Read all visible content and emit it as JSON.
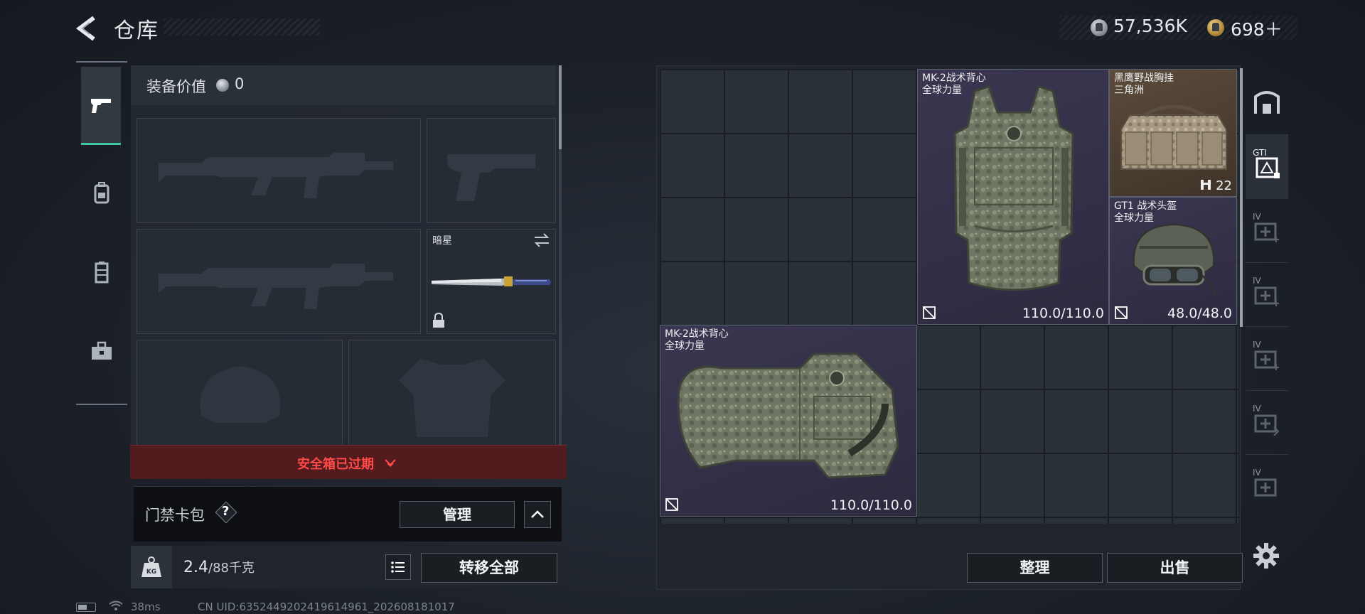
{
  "header": {
    "title": "仓库",
    "currency_silver": "57,536K",
    "currency_gold": "698＋"
  },
  "side_tabs": [
    {
      "icon": "pistol-icon",
      "active": true
    },
    {
      "icon": "backpack-icon",
      "active": false
    },
    {
      "icon": "vest-icon",
      "active": false
    },
    {
      "icon": "toolbox-icon",
      "active": false
    }
  ],
  "equipment": {
    "value_label": "装备价值",
    "value": "0",
    "melee_name": "暗星",
    "safebox_expired": "安全箱已过期",
    "keycard_label": "门禁卡包",
    "manage_label": "管理",
    "weight_current": "2.4",
    "weight_max": "/88千克",
    "transfer_all_label": "转移全部"
  },
  "status": {
    "ping": "38ms",
    "uid": "CN UID:6352449202419614961_202608181017"
  },
  "stash_items": [
    {
      "name": "MK-2战术背心",
      "sub": "全球力量",
      "durability": "110.0/110.0"
    },
    {
      "name": "黑鹰野战胸挂",
      "sub": "三角洲",
      "count": "22"
    },
    {
      "name": "GT1 战术头盔",
      "sub": "全球力量",
      "durability": "48.0/48.0"
    },
    {
      "name": "MK-2战术背心",
      "sub": "全球力量",
      "durability": "110.0/110.0"
    }
  ],
  "stash_tabs": [
    {
      "icon": "warehouse-icon",
      "label": ""
    },
    {
      "icon": "stash-page-icon",
      "label": "GTI"
    },
    {
      "icon": "add-page-icon",
      "label": "IV"
    },
    {
      "icon": "add-page-icon",
      "label": "IV"
    },
    {
      "icon": "add-page-icon",
      "label": "IV"
    },
    {
      "icon": "add-page-icon",
      "label": "IV"
    },
    {
      "icon": "add-page-icon",
      "label": "IV"
    }
  ],
  "stash_actions": {
    "sort_label": "整理",
    "sell_label": "出售"
  },
  "colors": {
    "accent": "#3fc6a2",
    "expired": "#ff4a48",
    "purple_rarity": "#3a3650",
    "gold_rarity": "#5b4a3a"
  }
}
